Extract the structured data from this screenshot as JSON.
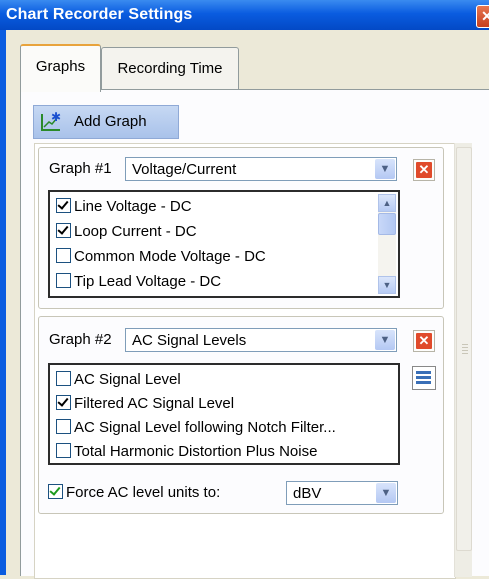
{
  "window": {
    "title": "Chart Recorder Settings",
    "close_glyph": "✕"
  },
  "tabs": [
    {
      "label": "Graphs",
      "active": true
    },
    {
      "label": "Recording Time",
      "active": false
    }
  ],
  "toolbar": {
    "add_graph_label": "Add Graph",
    "add_graph_icon": "chart-add-icon"
  },
  "graphs": [
    {
      "label": "Graph #1",
      "type": "Voltage/Current",
      "items": [
        {
          "label": "Line Voltage - DC",
          "checked": true
        },
        {
          "label": "Loop Current - DC",
          "checked": true
        },
        {
          "label": "Common Mode Voltage - DC",
          "checked": false
        },
        {
          "label": "Tip Lead Voltage - DC",
          "checked": false
        }
      ]
    },
    {
      "label": "Graph #2",
      "type": "AC Signal Levels",
      "items": [
        {
          "label": "AC Signal Level",
          "checked": false
        },
        {
          "label": "Filtered AC Signal Level",
          "checked": true
        },
        {
          "label": "AC Signal Level following Notch Filter...",
          "checked": false
        },
        {
          "label": "Total Harmonic Distortion Plus Noise",
          "checked": false
        }
      ],
      "force_units": {
        "label": "Force AC level units to:",
        "checked": true,
        "value": "dBV"
      }
    }
  ],
  "icons": {
    "delete": "delete-icon",
    "properties": "properties-icon",
    "dropdown": "chevron-down-icon"
  },
  "colors": {
    "title_bar": "#0a5ce0",
    "delete_red": "#e04a2b",
    "check_green": "#1d9a1d"
  }
}
